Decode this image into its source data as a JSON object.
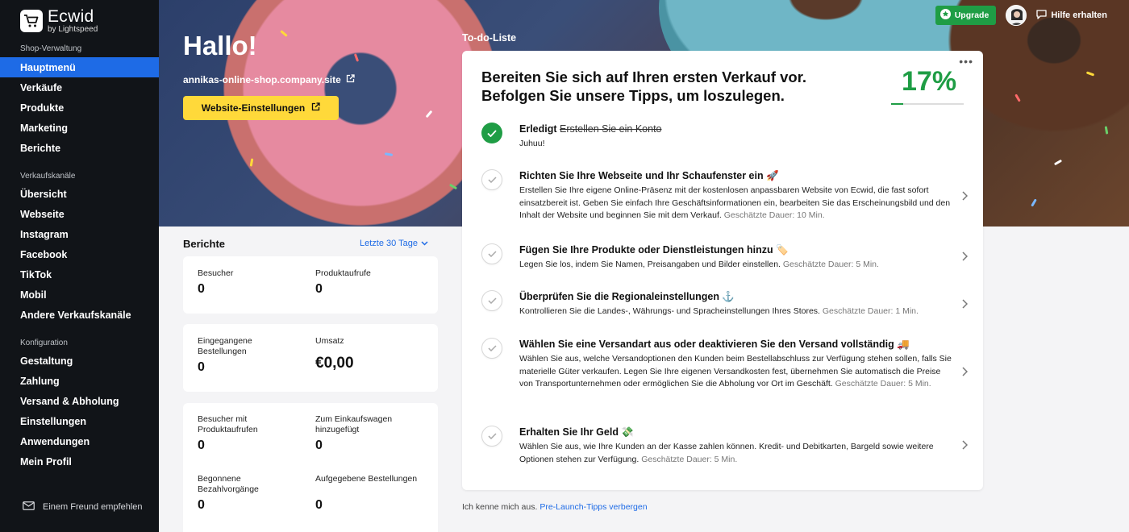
{
  "brand": {
    "name": "Ecwid",
    "sub": "by Lightspeed",
    "icon": "shopping-cart-icon"
  },
  "sidebar": {
    "sections": [
      {
        "title": "Shop-Verwaltung",
        "items": [
          "Hauptmenü",
          "Verkäufe",
          "Produkte",
          "Marketing",
          "Berichte"
        ]
      },
      {
        "title": "Verkaufskanäle",
        "items": [
          "Übersicht",
          "Webseite",
          "Instagram",
          "Facebook",
          "TikTok",
          "Mobil",
          "Andere Verkaufskanäle"
        ]
      },
      {
        "title": "Konfiguration",
        "items": [
          "Gestaltung",
          "Zahlung",
          "Versand & Abholung",
          "Einstellungen",
          "Anwendungen",
          "Mein Profil"
        ]
      }
    ],
    "active_item": "Hauptmenü",
    "footer": "Einem Freund empfehlen"
  },
  "header": {
    "upgrade": "Upgrade",
    "help": "Hilfe erhalten"
  },
  "hero": {
    "greeting": "Hallo!",
    "shop_url": "annikas-online-shop.company.site",
    "settings_button": "Website-Einstellungen",
    "todo_label": "To-do-Liste"
  },
  "reports": {
    "title": "Berichte",
    "range": "Letzte 30 Tage",
    "cards": [
      [
        {
          "label": "Besucher",
          "value": "0"
        },
        {
          "label": "Produktaufrufe",
          "value": "0"
        }
      ],
      [
        {
          "label": "Eingegangene Bestellungen",
          "value": "0"
        },
        {
          "label": "Umsatz",
          "value": "€0,00"
        }
      ],
      [
        {
          "label": "Besucher mit Produktaufrufen",
          "value": "0"
        },
        {
          "label": "Zum Einkaufswagen hinzugefügt",
          "value": "0"
        },
        {
          "label": "Begonnene Bezahlvorgänge",
          "value": "0"
        },
        {
          "label": "Aufgegebene Bestellungen",
          "value": "0"
        }
      ]
    ]
  },
  "todo": {
    "heading_line1": "Bereiten Sie sich auf Ihren ersten Verkauf vor.",
    "heading_line2": "Befolgen Sie unsere Tipps, um loszulegen.",
    "percent": "17%",
    "progress": 0.17,
    "tasks": [
      {
        "done": true,
        "prefix": "Erledigt",
        "title": "Erstellen Sie ein Konto",
        "desc": "Juhuu!",
        "est": ""
      },
      {
        "done": false,
        "title": "Richten Sie Ihre Webseite und Ihr Schaufenster ein 🚀",
        "desc": "Erstellen Sie Ihre eigene Online-Präsenz mit der kostenlosen anpassbaren Website von Ecwid, die fast sofort einsatzbereit ist. Geben Sie einfach Ihre Geschäftsinformationen ein, bearbeiten Sie das Erscheinungsbild und den Inhalt der Website und beginnen Sie mit dem Verkauf.",
        "est": "Geschätzte Dauer: 10 Min."
      },
      {
        "done": false,
        "title": "Fügen Sie Ihre Produkte oder Dienstleistungen hinzu 🏷️",
        "desc": "Legen Sie los, indem Sie Namen, Preisangaben und Bilder einstellen.",
        "est": "Geschätzte Dauer: 5 Min."
      },
      {
        "done": false,
        "title": "Überprüfen Sie die Regionaleinstellungen ⚓",
        "desc": "Kontrollieren Sie die Landes-, Währungs- und Spracheinstellungen Ihres Stores.",
        "est": "Geschätzte Dauer: 1 Min."
      },
      {
        "done": false,
        "title": "Wählen Sie eine Versandart aus oder deaktivieren Sie den Versand vollständig 🚚",
        "desc": "Wählen Sie aus, welche Versandoptionen den Kunden beim Bestellabschluss zur Verfügung stehen sollen, falls Sie materielle Güter verkaufen. Legen Sie Ihre eigenen Versandkosten fest, übernehmen Sie automatisch die Preise von Transportunternehmen oder ermöglichen Sie die Abholung vor Ort im Geschäft.",
        "est": "Geschätzte Dauer: 5 Min."
      },
      {
        "done": false,
        "title": "Erhalten Sie Ihr Geld 💸",
        "desc": "Wählen Sie aus, wie Ihre Kunden an der Kasse zahlen können. Kredit- und Debitkarten, Bargeld sowie weitere Optionen stehen zur Verfügung.",
        "est": "Geschätzte Dauer: 5 Min."
      }
    ],
    "hide_prefix": "Ich kenne mich aus.",
    "hide_link": "Pre-Launch-Tipps verbergen"
  }
}
